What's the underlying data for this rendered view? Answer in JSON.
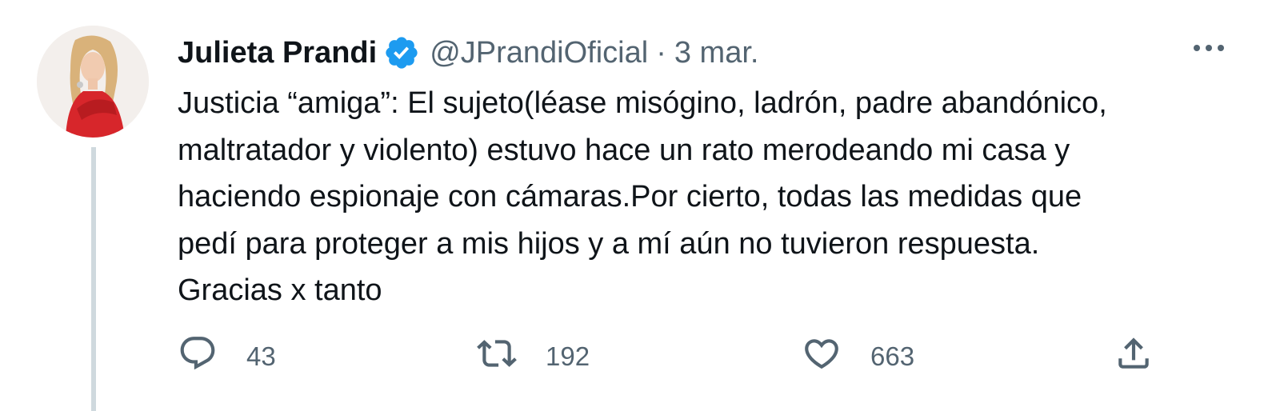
{
  "tweet": {
    "author_name": "Julieta Prandi",
    "handle": "@JPrandiOficial",
    "separator": "·",
    "date": "3 mar.",
    "text_lines": [
      "Justicia “amiga”: El sujeto(léase misógino, ladrón, padre abandónico,",
      "maltratador y violento) estuvo hace un rato merodeando mi casa y",
      "haciendo espionaje con cámaras.Por cierto, todas las medidas que",
      "pedí para proteger a mis hijos y a mí aún no tuvieron respuesta.",
      "Gracias x tanto"
    ],
    "reply_count": "43",
    "retweet_count": "192",
    "like_count": "663"
  },
  "icons": {
    "verified": "verified-badge-icon",
    "more": "more-horizontal-icon",
    "reply": "reply-icon",
    "retweet": "retweet-icon",
    "like": "heart-icon",
    "share": "share-icon"
  },
  "colors": {
    "text": "#0f1419",
    "secondary": "#536471",
    "verified": "#1d9bf0",
    "thread_line": "#cfd9de"
  }
}
